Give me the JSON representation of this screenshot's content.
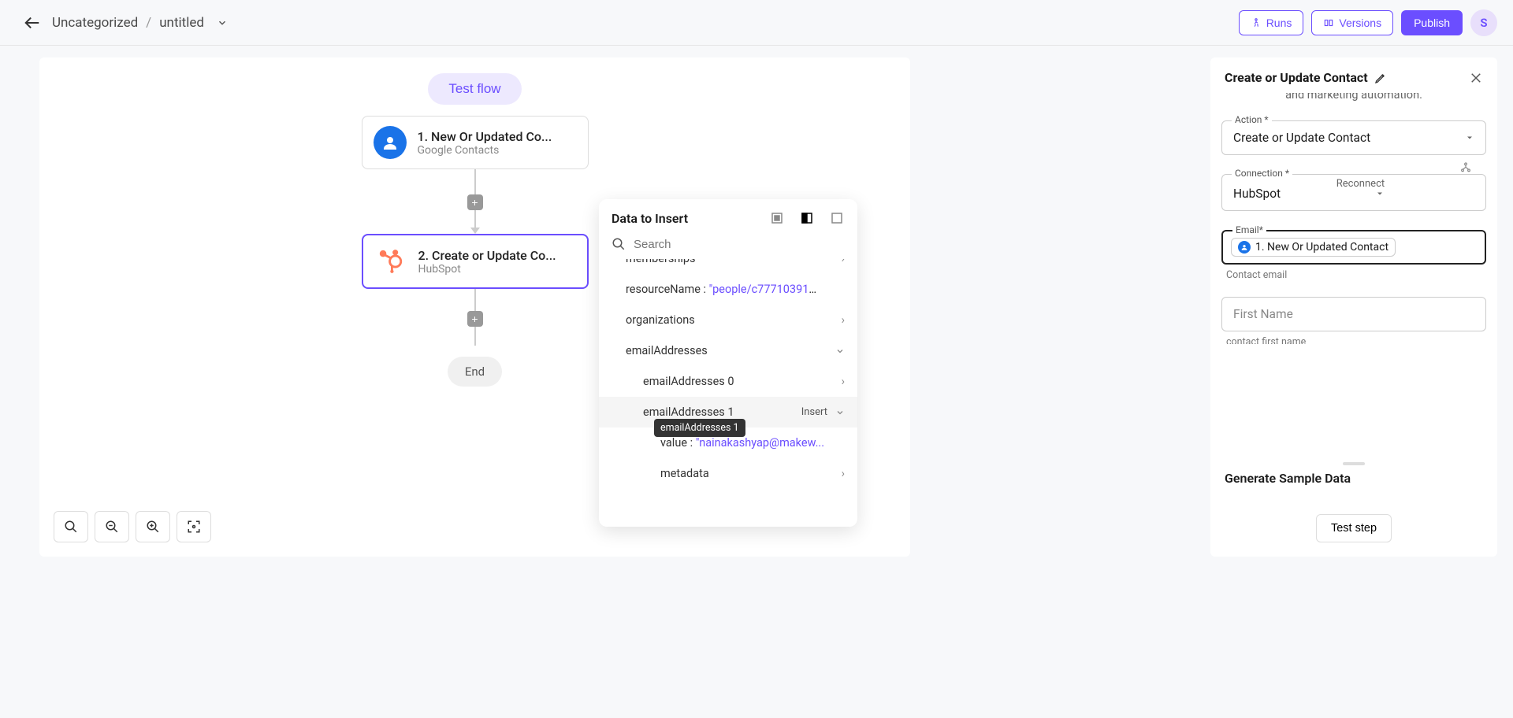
{
  "header": {
    "breadcrumb_category": "Uncategorized",
    "breadcrumb_name": "untitled",
    "runs_btn": "Runs",
    "versions_btn": "Versions",
    "publish_btn": "Publish",
    "avatar_letter": "S"
  },
  "canvas": {
    "test_flow": "Test flow",
    "node1_title": "1. New Or Updated Co...",
    "node1_sub": "Google Contacts",
    "node2_title": "2. Create or Update Co...",
    "node2_sub": "HubSpot",
    "end_label": "End"
  },
  "popover": {
    "title": "Data to Insert",
    "search_placeholder": "Search",
    "items": {
      "memberships": "memberships",
      "resourceName_key": "resourceName :",
      "resourceName_val": "\"people/c777103913...",
      "organizations": "organizations",
      "emailAddresses": "emailAddresses",
      "emailAddresses0": "emailAddresses 0",
      "emailAddresses1": "emailAddresses 1",
      "insert": "Insert",
      "value_key": "value :",
      "value_val": "\"nainakashyap@makew...",
      "metadata": "metadata"
    },
    "tooltip": "emailAddresses 1"
  },
  "panel": {
    "title": "Create or Update Contact",
    "description_line": "and marketing automation.",
    "action_label": "Action *",
    "action_value": "Create or Update Contact",
    "connection_label": "Connection *",
    "connection_value": "HubSpot",
    "reconnect": "Reconnect",
    "email_label": "Email*",
    "email_chip": "1. New Or Updated Contact",
    "email_helper": "Contact email",
    "firstname_placeholder": "First Name",
    "firstname_helper": "contact first name",
    "gen_sample": "Generate Sample Data",
    "test_step": "Test step"
  }
}
